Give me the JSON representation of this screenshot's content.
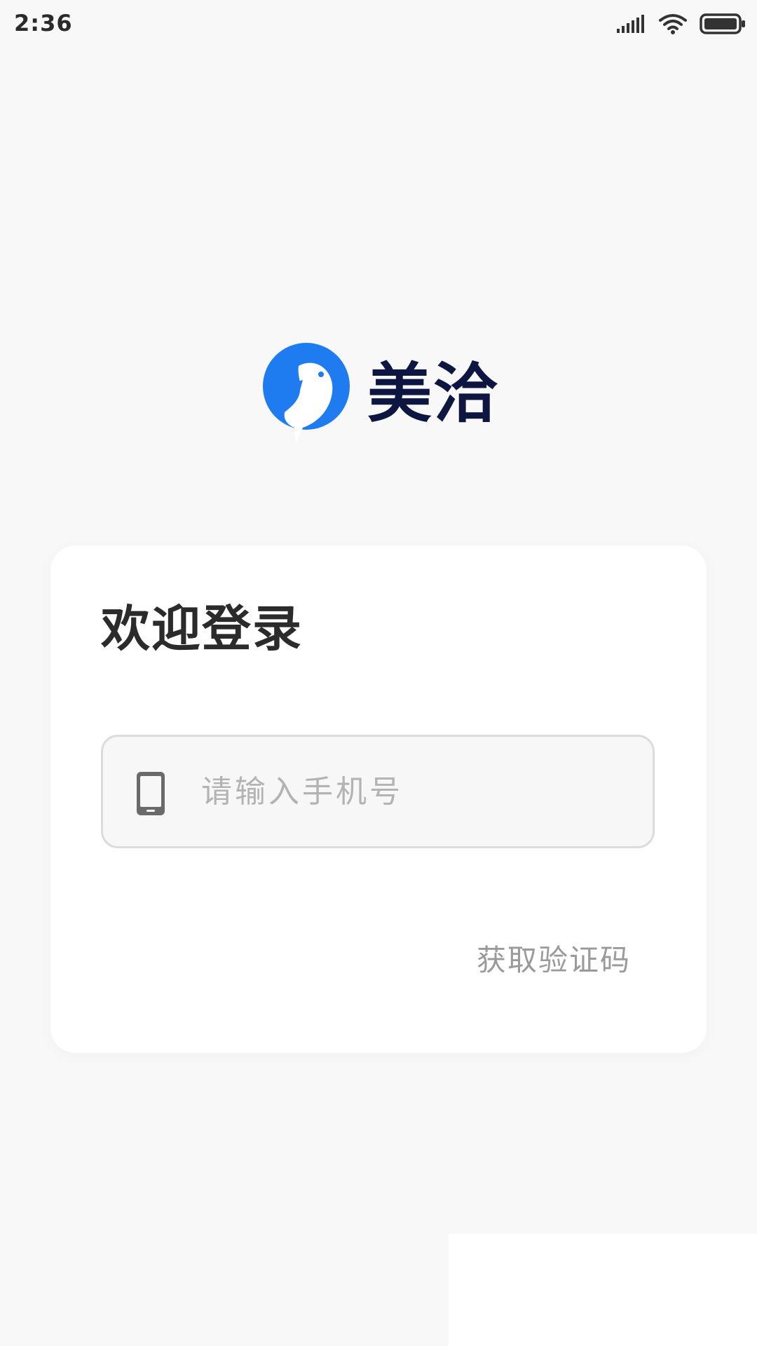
{
  "status_bar": {
    "time": "2:36",
    "icons": [
      "signal-icon",
      "wifi-icon",
      "battery-icon"
    ]
  },
  "app": {
    "name": "美洽",
    "brand_color": "#1f7cf0",
    "text_color": "#0d1640"
  },
  "login": {
    "title": "欢迎登录",
    "phone_placeholder": "请输入手机号",
    "phone_value": "",
    "get_code_label": "获取验证码"
  }
}
